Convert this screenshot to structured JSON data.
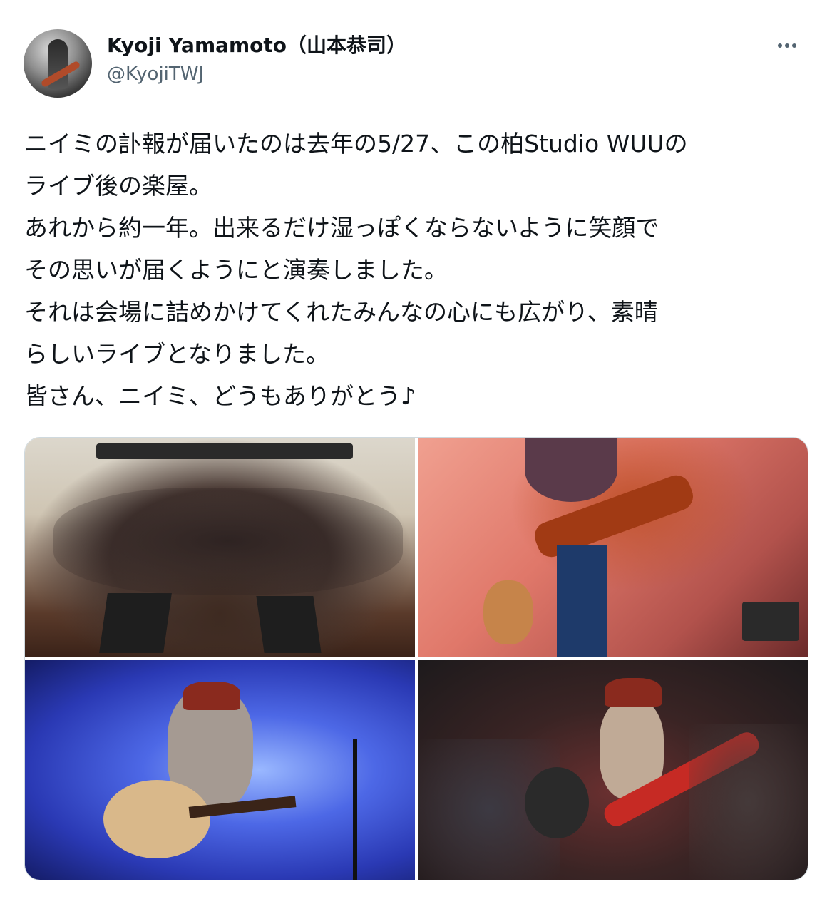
{
  "author": {
    "display_name": "Kyoji Yamamoto（山本恭司）",
    "handle": "@KyojiTWJ"
  },
  "tweet": {
    "lines": [
      "ニイミの訃報が届いたのは去年の5/27、この柏Studio WUUの",
      "ライブ後の楽屋。",
      "あれから約一年。出来るだけ湿っぽくならないように笑顔で",
      "その思いが届くようにと演奏しました。",
      "それは会場に詰めかけてくれたみんなの心にも広がり、素晴",
      "らしいライブとなりました。",
      "皆さん、ニイミ、どうもありがとう♪"
    ]
  },
  "icons": {
    "more": "more-horizontal-icon"
  },
  "media": {
    "photo_count": 4,
    "photos": [
      "group-audience-photo",
      "electric-guitar-performance-photo",
      "acoustic-guitar-performance-photo",
      "crowd-electric-guitar-photo"
    ]
  },
  "colors": {
    "text": "#0f1419",
    "secondary": "#536471",
    "border": "#cfd9de"
  }
}
